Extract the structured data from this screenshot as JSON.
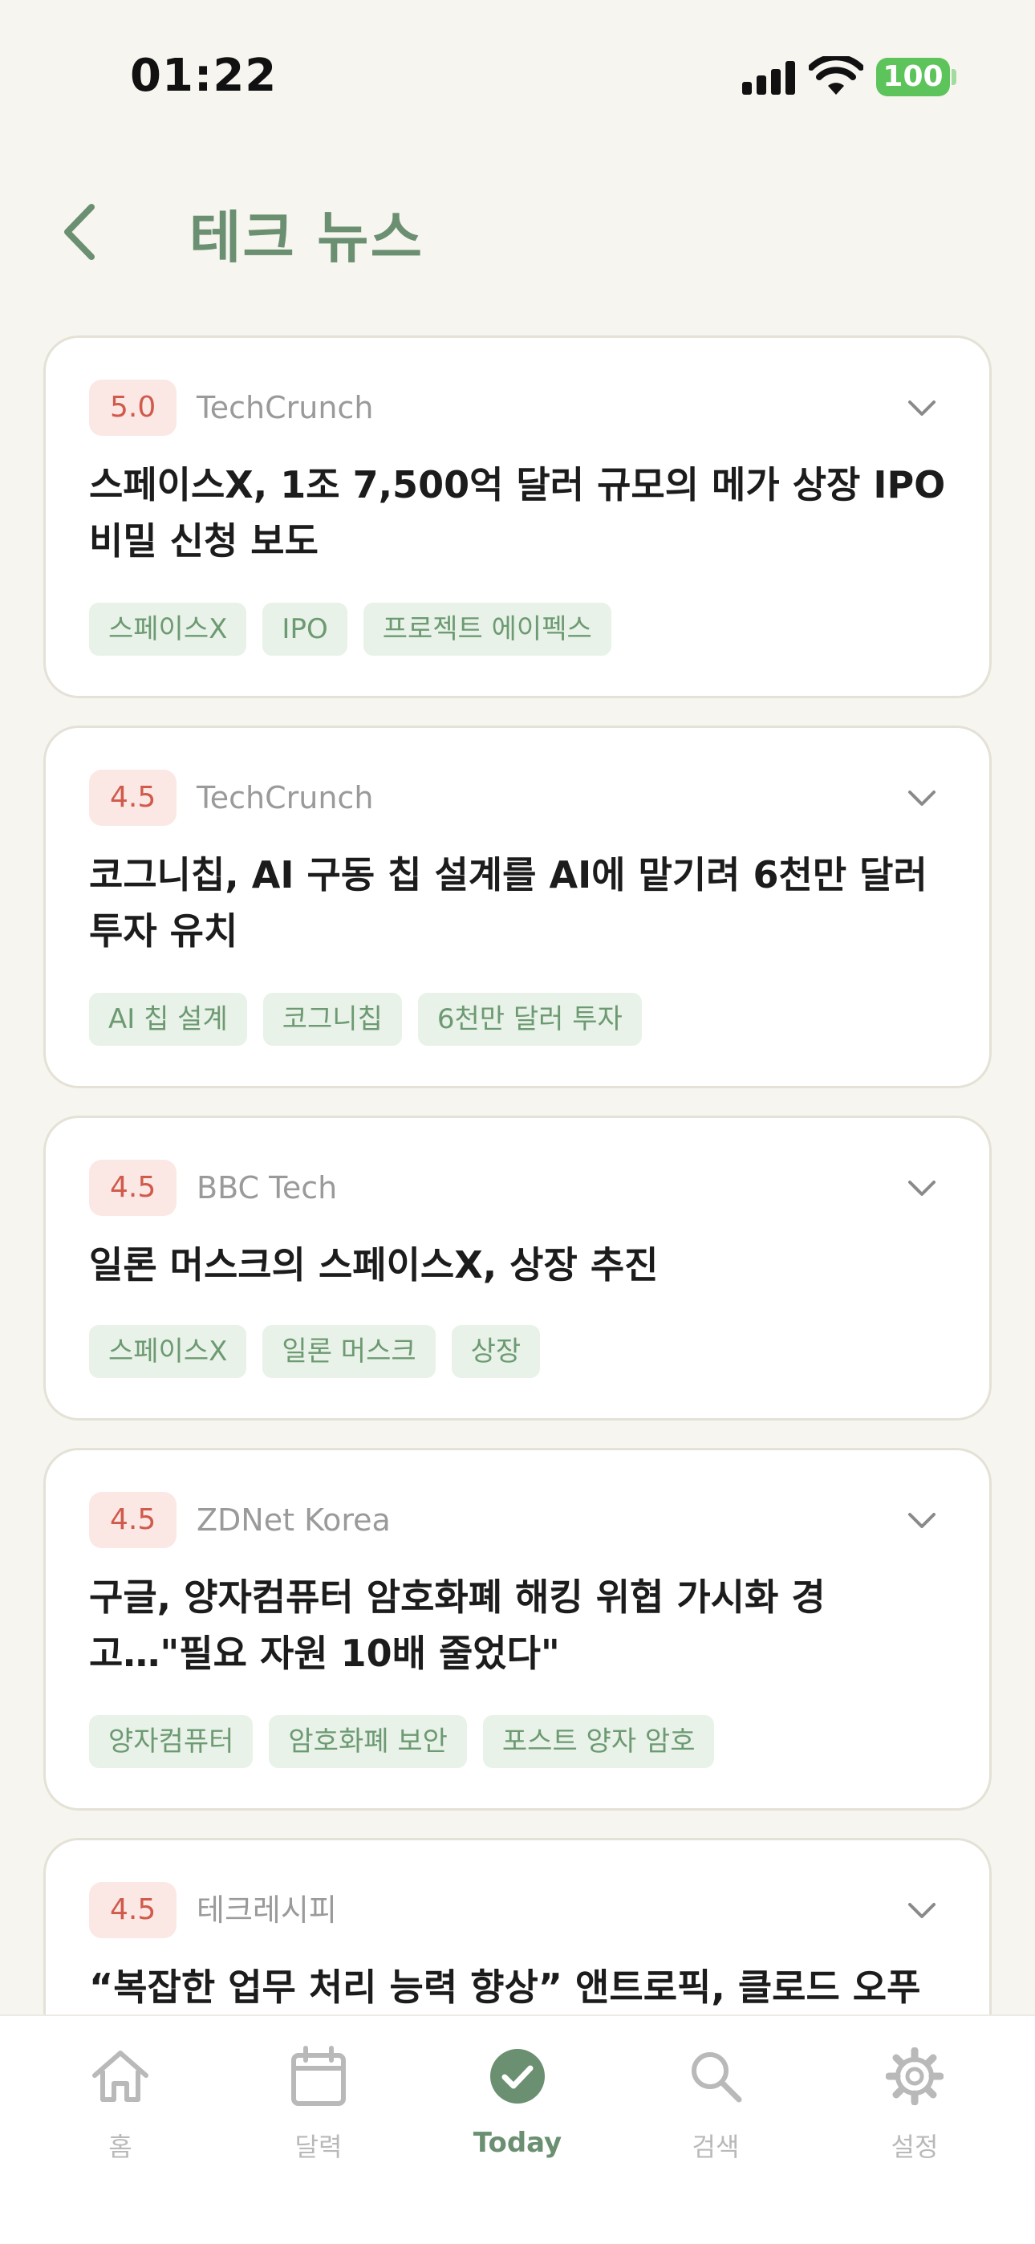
{
  "status_bar": {
    "time": "01:22",
    "battery": "100"
  },
  "header": {
    "title": "테크 뉴스"
  },
  "articles": [
    {
      "score": "5.0",
      "source": "TechCrunch",
      "title": "스페이스X, 1조 7,500억 달러 규모의 메가 상장 IPO 비밀 신청 보도",
      "tags": [
        "스페이스X",
        "IPO",
        "프로젝트 에이펙스"
      ]
    },
    {
      "score": "4.5",
      "source": "TechCrunch",
      "title": "코그니칩, AI 구동 칩 설계를 AI에 맡기려 6천만 달러 투자 유치",
      "tags": [
        "AI 칩 설계",
        "코그니칩",
        "6천만 달러 투자"
      ]
    },
    {
      "score": "4.5",
      "source": "BBC Tech",
      "title": "일론 머스크의 스페이스X, 상장 추진",
      "tags": [
        "스페이스X",
        "일론 머스크",
        "상장"
      ]
    },
    {
      "score": "4.5",
      "source": "ZDNet Korea",
      "title": "구글, 양자컴퓨터 암호화폐 해킹 위협 가시화 경고…\"필요 자원 10배 줄었다\"",
      "tags": [
        "양자컴퓨터",
        "암호화폐 보안",
        "포스트 양자 암호"
      ]
    },
    {
      "score": "4.5",
      "source": "테크레시피",
      "title": "“복잡한 업무 처리 능력 향상” 앤트로픽, 클로드 오푸스",
      "tags": []
    }
  ],
  "tabbar": {
    "items": [
      {
        "label": "홈",
        "icon": "home-icon"
      },
      {
        "label": "달력",
        "icon": "calendar-icon"
      },
      {
        "label": "Today",
        "icon": "check-circle-icon",
        "active": true
      },
      {
        "label": "검색",
        "icon": "search-icon"
      },
      {
        "label": "설정",
        "icon": "gear-icon"
      }
    ]
  },
  "colors": {
    "background": "#F7F5EF",
    "accent": "#6B8F71",
    "score_bg": "#FBE7E4",
    "score_text": "#D05A4C",
    "tag_bg": "#E8F2E8",
    "tag_text": "#6D9A72"
  }
}
